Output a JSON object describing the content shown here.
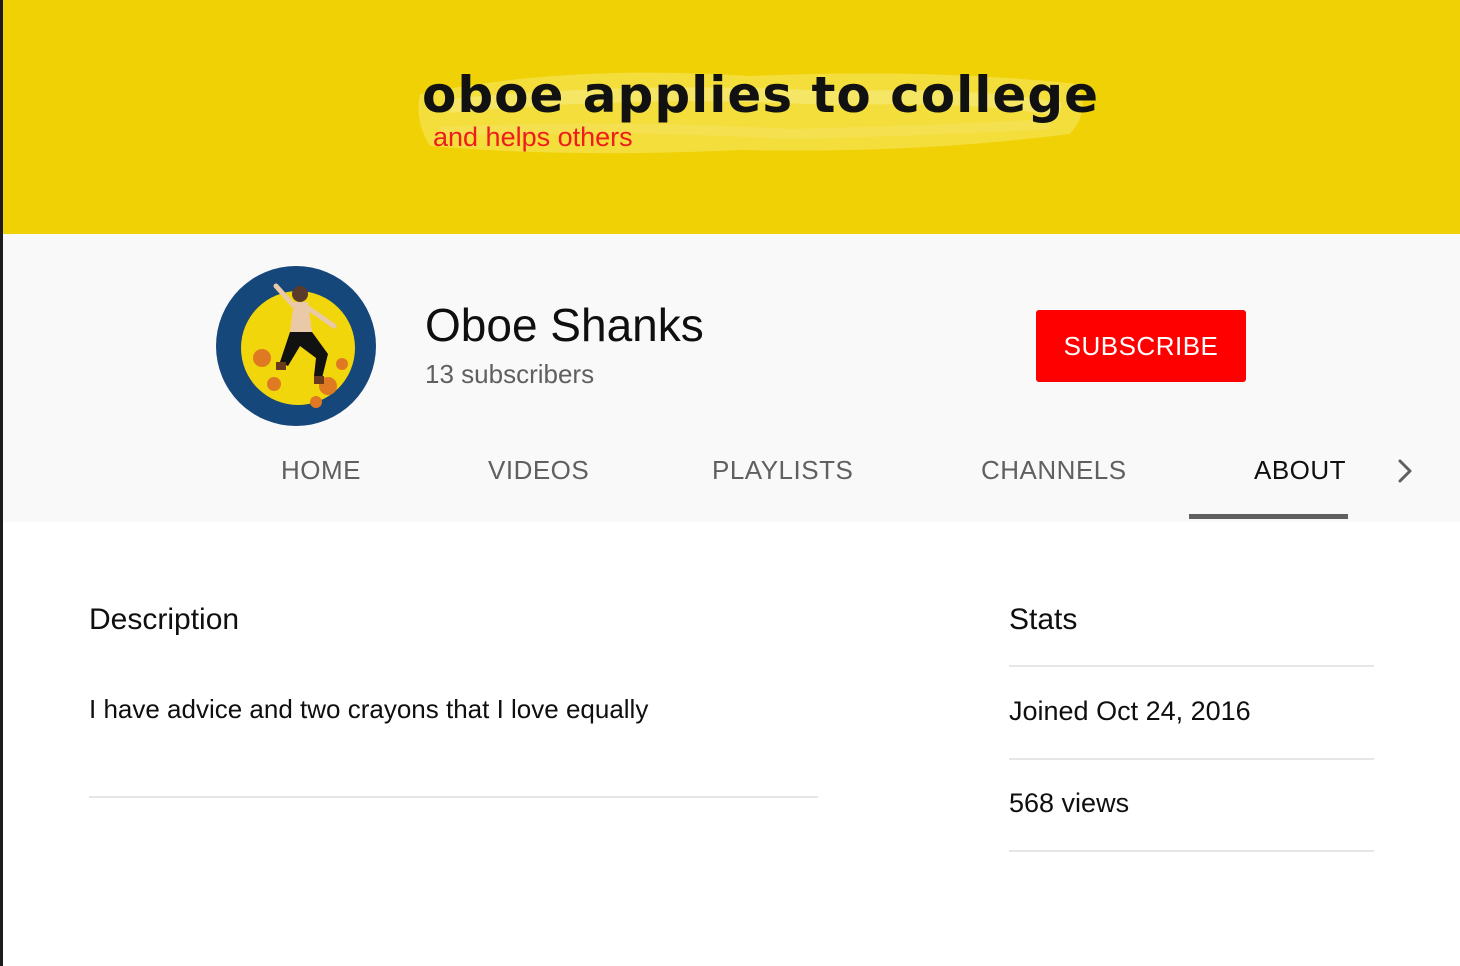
{
  "banner": {
    "title": "oboe applies to college",
    "subtitle": "and helps others"
  },
  "channel": {
    "name": "Oboe Shanks",
    "subscribers": "13 subscribers",
    "subscribe_label": "SUBSCRIBE"
  },
  "tabs": [
    {
      "label": "HOME",
      "active": false
    },
    {
      "label": "VIDEOS",
      "active": false
    },
    {
      "label": "PLAYLISTS",
      "active": false
    },
    {
      "label": "CHANNELS",
      "active": false
    },
    {
      "label": "ABOUT",
      "active": true
    }
  ],
  "about": {
    "description_title": "Description",
    "description_text": "I have advice and two crayons that I love equally",
    "stats_title": "Stats",
    "joined": "Joined Oct 24, 2016",
    "views": "568 views"
  },
  "colors": {
    "banner_bg": "#efd106",
    "subscribe_bg": "#ff0000",
    "avatar_bg": "#16477a",
    "subtitle_red": "#ee1c1c"
  },
  "icons": {
    "tabs_next": "chevron-right-icon"
  }
}
